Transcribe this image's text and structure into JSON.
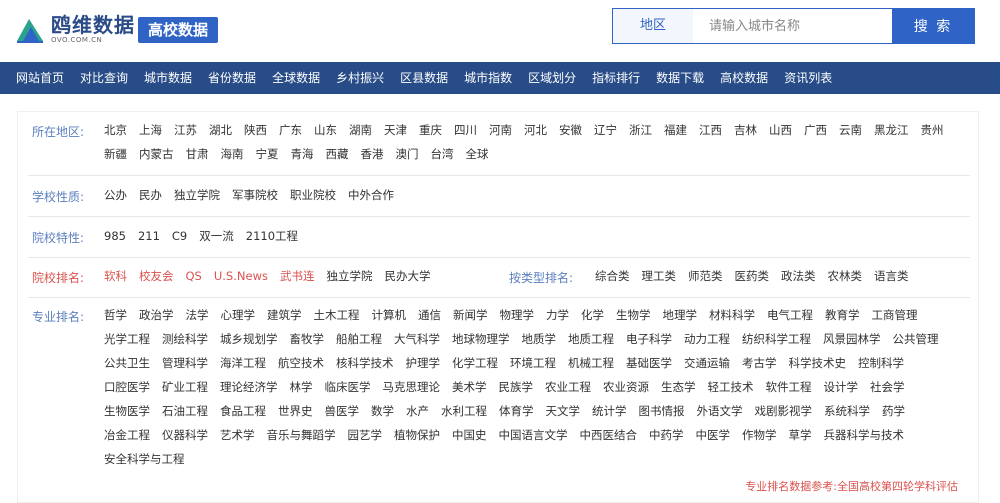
{
  "logo": {
    "name": "鸥维数据",
    "url": "OVO.COM.CN"
  },
  "section_badge": "高校数据",
  "search": {
    "scope": "地区",
    "placeholder": "请输入城市名称",
    "button": "搜 索"
  },
  "nav": [
    "网站首页",
    "对比查询",
    "城市数据",
    "省份数据",
    "全球数据",
    "乡村振兴",
    "区县数据",
    "城市指数",
    "区域划分",
    "指标排行",
    "数据下载",
    "高校数据",
    "资讯列表"
  ],
  "filters": {
    "region": {
      "label": "所在地区:",
      "items": [
        "北京",
        "上海",
        "江苏",
        "湖北",
        "陕西",
        "广东",
        "山东",
        "湖南",
        "天津",
        "重庆",
        "四川",
        "河南",
        "河北",
        "安徽",
        "辽宁",
        "浙江",
        "福建",
        "江西",
        "吉林",
        "山西",
        "广西",
        "云南",
        "黑龙江",
        "贵州",
        "新疆",
        "内蒙古",
        "甘肃",
        "海南",
        "宁夏",
        "青海",
        "西藏",
        "香港",
        "澳门",
        "台湾",
        "全球"
      ]
    },
    "nature": {
      "label": "学校性质:",
      "items": [
        "公办",
        "民办",
        "独立学院",
        "军事院校",
        "职业院校",
        "中外合作"
      ]
    },
    "feature": {
      "label": "院校特性:",
      "items": [
        "985",
        "211",
        "C9",
        "双一流",
        "2110工程"
      ]
    },
    "ranking": {
      "label": "院校排名:",
      "items_red": [
        "软科",
        "校友会",
        "QS",
        "U.S.News",
        "武书连"
      ],
      "items": [
        "独立学院",
        "民办大学"
      ],
      "type_label": "按类型排名:",
      "type_items": [
        "综合类",
        "理工类",
        "师范类",
        "医药类",
        "政法类",
        "农林类",
        "语言类"
      ]
    },
    "major": {
      "label": "专业排名:",
      "items": [
        "哲学",
        "政治学",
        "法学",
        "心理学",
        "建筑学",
        "土木工程",
        "计算机",
        "通信",
        "新闻学",
        "物理学",
        "力学",
        "化学",
        "生物学",
        "地理学",
        "材料科学",
        "电气工程",
        "教育学",
        "工商管理",
        "光学工程",
        "测绘科学",
        "城乡规划学",
        "畜牧学",
        "船舶工程",
        "大气科学",
        "地球物理学",
        "地质学",
        "地质工程",
        "电子科学",
        "动力工程",
        "纺织科学工程",
        "风景园林学",
        "公共管理",
        "公共卫生",
        "管理科学",
        "海洋工程",
        "航空技术",
        "核科学技术",
        "护理学",
        "化学工程",
        "环境工程",
        "机械工程",
        "基础医学",
        "交通运输",
        "考古学",
        "科学技术史",
        "控制科学",
        "口腔医学",
        "矿业工程",
        "理论经济学",
        "林学",
        "临床医学",
        "马克思理论",
        "美术学",
        "民族学",
        "农业工程",
        "农业资源",
        "生态学",
        "轻工技术",
        "软件工程",
        "设计学",
        "社会学",
        "生物医学",
        "石油工程",
        "食品工程",
        "世界史",
        "兽医学",
        "数学",
        "水产",
        "水利工程",
        "体育学",
        "天文学",
        "统计学",
        "图书情报",
        "外语文学",
        "戏剧影视学",
        "系统科学",
        "药学",
        "冶金工程",
        "仪器科学",
        "艺术学",
        "音乐与舞蹈学",
        "园艺学",
        "植物保护",
        "中国史",
        "中国语言文学",
        "中西医结合",
        "中药学",
        "中医学",
        "作物学",
        "草学",
        "兵器科学与技术",
        "安全科学与工程"
      ]
    }
  },
  "note": "专业排名数据参考:全国高校第四轮学科评估",
  "colors": {
    "nav_bg": "#274c87",
    "accent": "#2f63c5",
    "label": "#5b7fbf",
    "red": "#d9534f"
  }
}
